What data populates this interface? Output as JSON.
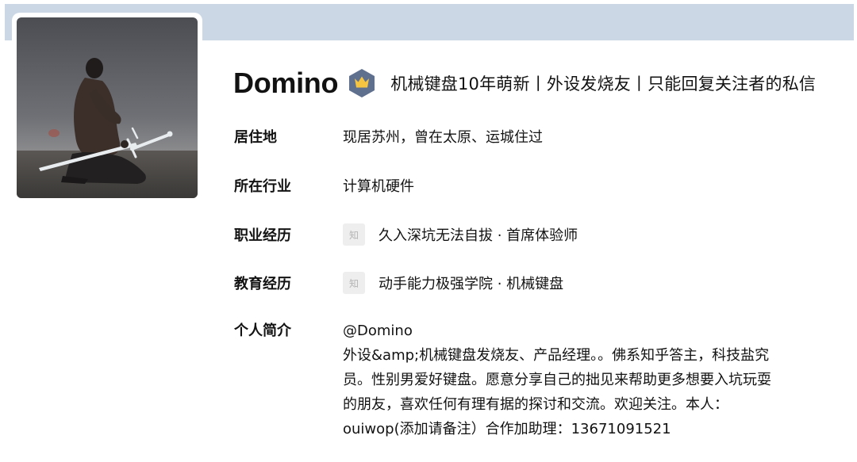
{
  "profile": {
    "name": "Domino",
    "badge_icon": "crown-badge-icon",
    "headline": "机械键盘10年萌新丨外设发烧友丨只能回复关注者的私信"
  },
  "fields": {
    "location": {
      "label": "居住地",
      "value": "现居苏州，曾在太原、运城住过"
    },
    "industry": {
      "label": "所在行业",
      "value": "计算机硬件"
    },
    "career": {
      "label": "职业经历",
      "icon_text": "知",
      "value": "久入深坑无法自拔 · 首席体验师"
    },
    "education": {
      "label": "教育经历",
      "icon_text": "知",
      "value": "动手能力极强学院 · 机械键盘"
    },
    "bio": {
      "label": "个人简介",
      "lines": [
        "@Domino",
        "外设&amp;机械键盘发烧友、产品经理。。佛系知乎答主，科技盐究",
        "员。性别男爱好键盘。愿意分享自己的拙见来帮助更多想要入坑玩耍",
        "的朋友，喜欢任何有理有据的探讨和交流。欢迎关注。本人：",
        "ouiwop(添加请备注）合作加助理：13671091521"
      ]
    }
  },
  "colors": {
    "cover": "#cbd7e5",
    "badge": "#5f6f8e",
    "badge_crown": "#f5c542",
    "text": "#121212"
  }
}
